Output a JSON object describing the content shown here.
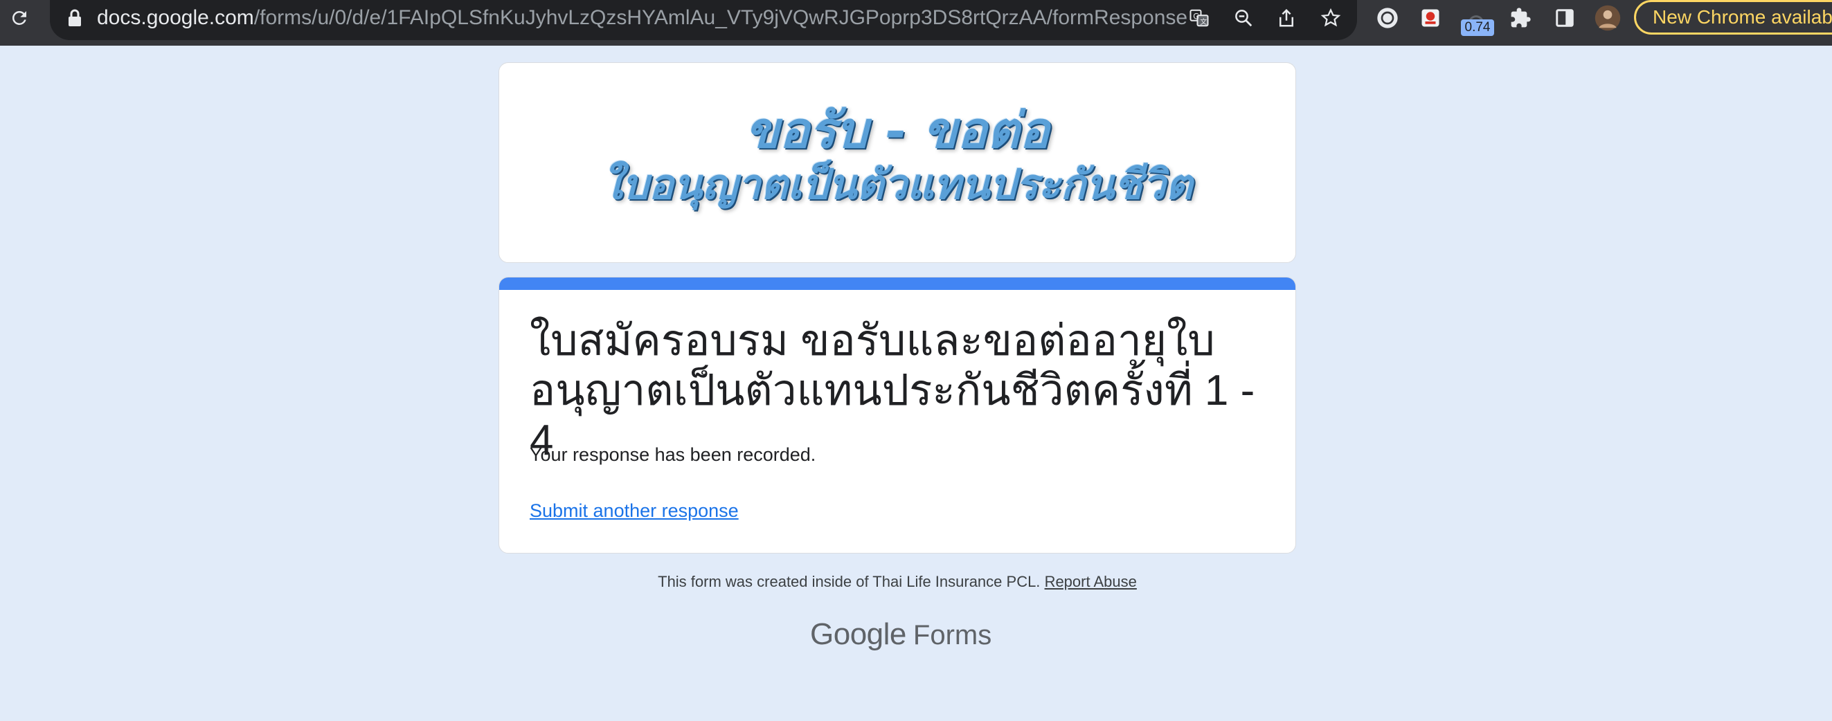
{
  "browser": {
    "url_host": "docs.google.com",
    "url_path": "/forms/u/0/d/e/1FAIpQLSfnKuJyhvLzQzsHYAmlAu_VTy9jVQwRJGPoprp3DS8rtQrzAA/formResponse",
    "extension_badge": "0.74",
    "update_button_label": "New Chrome available",
    "icons": [
      "reload-icon",
      "lock-icon",
      "translate-icon",
      "zoom-icon",
      "share-icon",
      "bookmark-star-icon",
      "extension-icon",
      "puzzle-icon",
      "side-panel-icon",
      "profile-avatar"
    ]
  },
  "header": {
    "banner_line1": "ขอรับ - ขอต่อ",
    "banner_line2": "ใบอนุญาตเป็นตัวแทนประกันชีวิต"
  },
  "form": {
    "accent_color": "#4285f4",
    "title": "ใบสมัครอบรม ขอรับและขอต่ออายุใบอนุญาตเป็นตัวแทนประกันชีวิตครั้งที่ 1 - 4",
    "confirmation": "Your response has been recorded.",
    "submit_another": "Submit another response"
  },
  "footer": {
    "created_text": "This form was created inside of Thai Life Insurance PCL.",
    "report_abuse": "Report Abuse",
    "logo_google": "Google",
    "logo_forms": "Forms"
  }
}
